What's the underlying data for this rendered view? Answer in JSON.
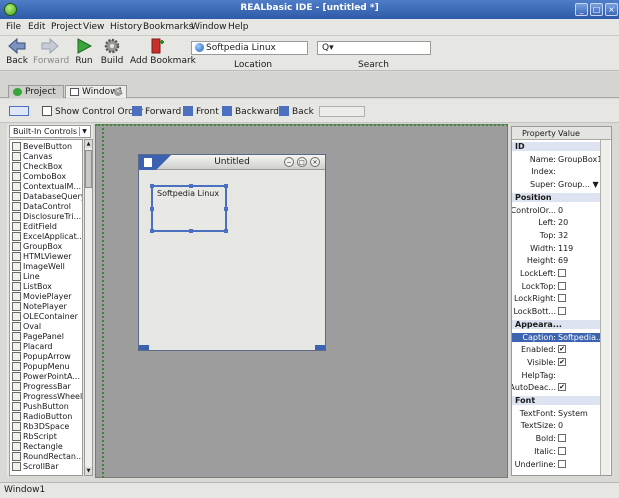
{
  "window": {
    "title": "REALbasic IDE - [untitled *]",
    "controls": [
      "minimize",
      "maximize",
      "close"
    ]
  },
  "menu": [
    "File",
    "Edit",
    "Project",
    "View",
    "History",
    "Bookmarks",
    "Window",
    "Help"
  ],
  "toolbar": {
    "back": "Back",
    "forward": "Forward",
    "run": "Run",
    "build": "Build",
    "add_bookmark": "Add Bookmark",
    "location_value": "Softpedia Linux",
    "location_label": "Location",
    "search_value": "Q▾",
    "search_label": "Search"
  },
  "tabs": [
    {
      "label": "Project",
      "active": false
    },
    {
      "label": "Window1",
      "active": true
    }
  ],
  "editor_toolbar": {
    "show_control_order": "Show Control Order",
    "forward": "Forward",
    "front": "Front",
    "backward": "Backward",
    "back": "Back"
  },
  "controls_panel": {
    "selector": "Built-In Controls",
    "items": [
      "BevelButton",
      "Canvas",
      "CheckBox",
      "ComboBox",
      "ContextualM...",
      "DatabaseQuery",
      "DataControl",
      "DisclosureTri...",
      "EditField",
      "ExcelApplicat...",
      "GroupBox",
      "HTMLViewer",
      "ImageWell",
      "Line",
      "ListBox",
      "MoviePlayer",
      "NotePlayer",
      "OLEContainer",
      "Oval",
      "PagePanel",
      "Placard",
      "PopupArrow",
      "PopupMenu",
      "PowerPointA...",
      "ProgressBar",
      "ProgressWheel",
      "PushButton",
      "RadioButton",
      "Rb3DSpace",
      "RbScript",
      "Rectangle",
      "RoundRectan...",
      "ScrollBar"
    ]
  },
  "design_window": {
    "title": "Untitled",
    "groupbox_caption": "Softpedia Linux"
  },
  "properties": {
    "header_property": "Property",
    "header_value": "Value",
    "rows": [
      {
        "type": "section",
        "key": "ID"
      },
      {
        "key": "Name:",
        "value": "GroupBox1"
      },
      {
        "key": "Index:",
        "value": ""
      },
      {
        "key": "Super:",
        "value": "Group... ▼"
      },
      {
        "type": "section",
        "key": "Position"
      },
      {
        "key": "ControlOr...",
        "value": "0"
      },
      {
        "key": "Left:",
        "value": "20"
      },
      {
        "key": "Top:",
        "value": "32"
      },
      {
        "key": "Width:",
        "value": "119"
      },
      {
        "key": "Height:",
        "value": "69"
      },
      {
        "key": "LockLeft:",
        "check": false
      },
      {
        "key": "LockTop:",
        "check": false
      },
      {
        "key": "LockRight:",
        "check": false
      },
      {
        "key": "LockBott...",
        "check": false
      },
      {
        "type": "section",
        "key": "Appeara..."
      },
      {
        "key": "Caption:",
        "value": "Softpedia...",
        "selected": true
      },
      {
        "key": "Enabled:",
        "check": true
      },
      {
        "key": "Visible:",
        "check": true
      },
      {
        "key": "HelpTag:",
        "value": ""
      },
      {
        "key": "AutoDeac...",
        "check": true
      },
      {
        "type": "section",
        "key": "Font"
      },
      {
        "key": "TextFont:",
        "value": "System"
      },
      {
        "key": "TextSize:",
        "value": "0"
      },
      {
        "key": "Bold:",
        "check": false
      },
      {
        "key": "Italic:",
        "check": false
      },
      {
        "key": "Underline:",
        "check": false
      }
    ]
  },
  "status": "Window1",
  "colors": {
    "titlebar": "#3d68b6",
    "canvas": "#9d9d9d",
    "accent": "#3d64b0",
    "run_green": "#3aa53a"
  }
}
